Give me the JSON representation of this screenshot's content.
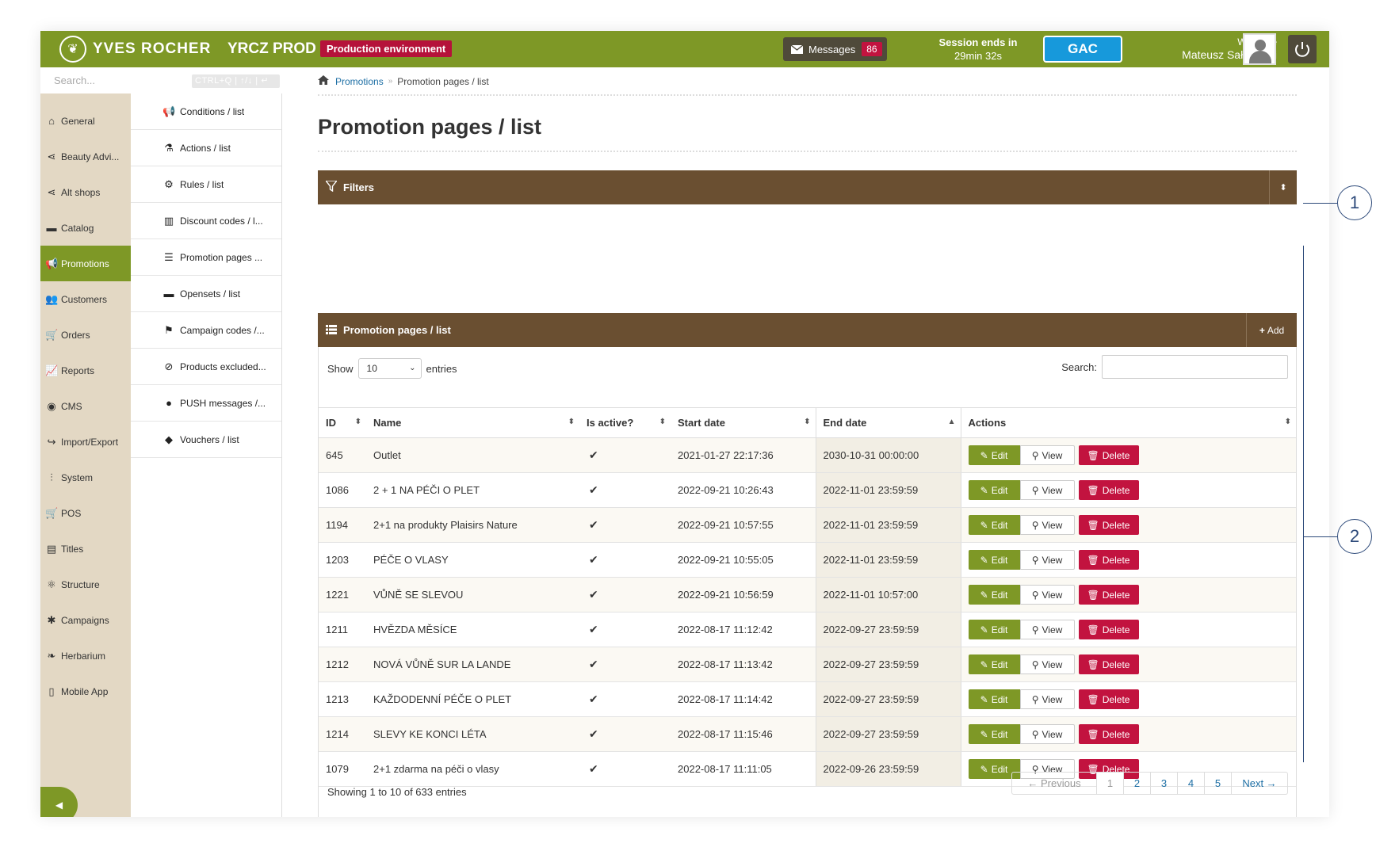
{
  "header": {
    "brand": "YVES ROCHER",
    "env_name": "YRCZ PROD",
    "env_badge": "Production environment",
    "messages_label": "Messages",
    "messages_count": "86",
    "session_title": "Session ends in",
    "session_time": "29min 32s",
    "gac_label": "GAC",
    "welcome_label": "Welcome",
    "user_name": "Mateusz Sałasiński"
  },
  "search": {
    "placeholder": "Search...",
    "shortcut": "CTRL+Q | ↑/↓ | ↵"
  },
  "sidebar": {
    "items": [
      {
        "label": "General",
        "icon": "home-icon"
      },
      {
        "label": "Beauty Advi...",
        "icon": "share-icon"
      },
      {
        "label": "Alt shops",
        "icon": "share-icon"
      },
      {
        "label": "Catalog",
        "icon": "folder-icon"
      },
      {
        "label": "Promotions",
        "icon": "bullhorn-icon"
      },
      {
        "label": "Customers",
        "icon": "users-icon"
      },
      {
        "label": "Orders",
        "icon": "cart-icon"
      },
      {
        "label": "Reports",
        "icon": "chart-icon"
      },
      {
        "label": "CMS",
        "icon": "globe-icon"
      },
      {
        "label": "Import/Export",
        "icon": "share-arrow-icon"
      },
      {
        "label": "System",
        "icon": "sliders-icon"
      },
      {
        "label": "POS",
        "icon": "cart-icon"
      },
      {
        "label": "Titles",
        "icon": "list-box-icon"
      },
      {
        "label": "Structure",
        "icon": "atom-icon"
      },
      {
        "label": "Campaigns",
        "icon": "asterisk-icon"
      },
      {
        "label": "Herbarium",
        "icon": "leaf-icon"
      },
      {
        "label": "Mobile App",
        "icon": "mobile-icon"
      }
    ]
  },
  "submenu": {
    "items": [
      {
        "label": "Conditions / list",
        "icon": "bullhorn-icon"
      },
      {
        "label": "Actions / list",
        "icon": "flask-icon"
      },
      {
        "label": "Rules / list",
        "icon": "cogs-icon"
      },
      {
        "label": "Discount codes / l...",
        "icon": "barcode-icon"
      },
      {
        "label": "Promotion pages ...",
        "icon": "list-icon"
      },
      {
        "label": "Opensets / list",
        "icon": "folder-icon"
      },
      {
        "label": "Campaign codes /...",
        "icon": "flag-icon"
      },
      {
        "label": "Products excluded...",
        "icon": "ban-icon"
      },
      {
        "label": "PUSH messages /...",
        "icon": "comment-icon"
      },
      {
        "label": "Vouchers / list",
        "icon": "tag-icon"
      }
    ]
  },
  "breadcrumb": {
    "link": "Promotions",
    "current": "Promotion pages / list"
  },
  "page": {
    "title": "Promotion pages / list",
    "filters_label": "Filters",
    "panel_title": "Promotion pages / list",
    "add_label": "Add"
  },
  "table_controls": {
    "show_label": "Show",
    "entries_value": "10",
    "entries_label": "entries",
    "search_label": "Search:"
  },
  "table": {
    "headers": [
      "ID",
      "Name",
      "Is active?",
      "Start date",
      "End date",
      "Actions"
    ],
    "rows": [
      {
        "id": "645",
        "name": "Outlet",
        "start": "2021-01-27 22:17:36",
        "end": "2030-10-31 00:00:00"
      },
      {
        "id": "1086",
        "name": "2 + 1 NA PÉČI O PLET",
        "start": "2022-09-21 10:26:43",
        "end": "2022-11-01 23:59:59"
      },
      {
        "id": "1194",
        "name": "2+1 na produkty Plaisirs Nature",
        "start": "2022-09-21 10:57:55",
        "end": "2022-11-01 23:59:59"
      },
      {
        "id": "1203",
        "name": "PÉČE O VLASY",
        "start": "2022-09-21 10:55:05",
        "end": "2022-11-01 23:59:59"
      },
      {
        "id": "1221",
        "name": "VŮNĚ SE SLEVOU",
        "start": "2022-09-21 10:56:59",
        "end": "2022-11-01 10:57:00"
      },
      {
        "id": "1211",
        "name": "HVĚZDA MĚSÍCE",
        "start": "2022-08-17 11:12:42",
        "end": "2022-09-27 23:59:59"
      },
      {
        "id": "1212",
        "name": "NOVÁ VŮNĚ SUR LA LANDE",
        "start": "2022-08-17 11:13:42",
        "end": "2022-09-27 23:59:59"
      },
      {
        "id": "1213",
        "name": "KAŽDODENNÍ PÉČE O PLET",
        "start": "2022-08-17 11:14:42",
        "end": "2022-09-27 23:59:59"
      },
      {
        "id": "1214",
        "name": "SLEVY KE KONCI LÉTA",
        "start": "2022-08-17 11:15:46",
        "end": "2022-09-27 23:59:59"
      },
      {
        "id": "1079",
        "name": "2+1 zdarma na péči o vlasy",
        "start": "2022-08-17 11:11:05",
        "end": "2022-09-26 23:59:59"
      }
    ],
    "edit_label": "Edit",
    "view_label": "View",
    "delete_label": "Delete"
  },
  "footer": {
    "showing": "Showing 1 to 10 of 633 entries",
    "prev": "← Previous",
    "pages": [
      "1",
      "2",
      "3",
      "4",
      "5"
    ],
    "next": "Next →"
  },
  "callouts": {
    "one": "1",
    "two": "2"
  },
  "colors": {
    "header_green": "#7e9826",
    "panel_brown": "#6a4f31",
    "delete_red": "#c2133f",
    "gac_blue": "#1799db"
  }
}
